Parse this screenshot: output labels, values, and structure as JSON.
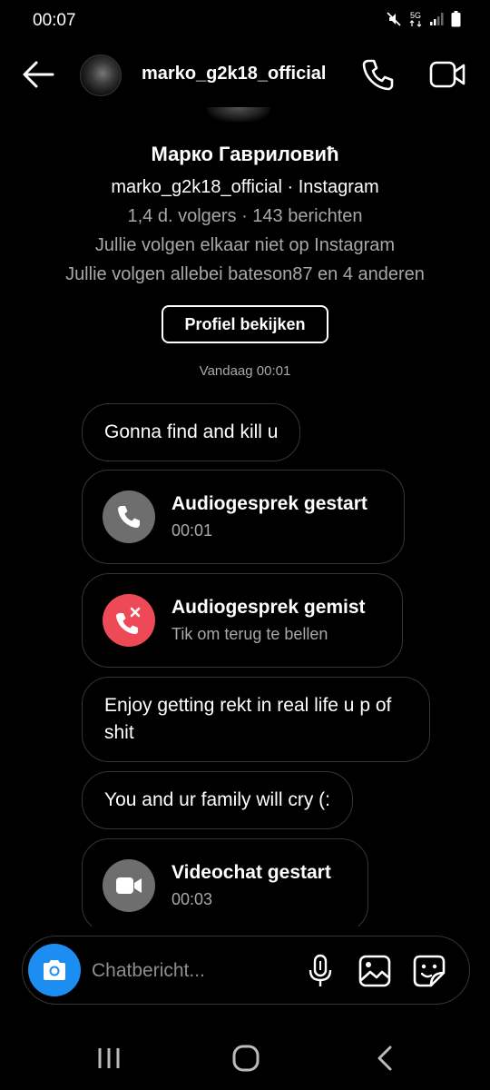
{
  "status_bar": {
    "time": "00:07",
    "network_label": "5G",
    "icons": [
      "mute-icon",
      "signal-icon",
      "battery-icon"
    ]
  },
  "header": {
    "username": "marko_g2k18_official",
    "icons": [
      "back-arrow-icon",
      "phone-icon",
      "video-camera-icon"
    ]
  },
  "profile": {
    "display_name": "Марко Гавриловић",
    "handle_line": "marko_g2k18_official · Instagram",
    "stats_line": "1,4 d. volgers · 143 berichten",
    "follow_status": "Jullie volgen elkaar niet op Instagram",
    "mutuals": "Jullie volgen allebei bateson87 en 4 anderen",
    "view_button": "Profiel bekijken"
  },
  "thread": {
    "timestamp": "Vandaag 00:01",
    "messages": [
      {
        "type": "text",
        "text": "Gonna find and kill u"
      },
      {
        "type": "call",
        "title": "Audiogesprek gestart",
        "subtitle": "00:01",
        "icon": "phone-icon",
        "icon_bg": "#6e6e6e"
      },
      {
        "type": "call",
        "title": "Audiogesprek gemist",
        "subtitle": "Tik om terug te bellen",
        "icon": "missed-call-icon",
        "icon_bg": "#ed4956"
      },
      {
        "type": "text",
        "text": "Enjoy getting rekt in real life u p of shit"
      },
      {
        "type": "text",
        "text": "You and ur family will cry (:"
      },
      {
        "type": "call",
        "title": "Videochat gestart",
        "subtitle": "00:03",
        "icon": "video-camera-icon",
        "icon_bg": "#6e6e6e"
      }
    ]
  },
  "composer": {
    "placeholder": "Chatbericht...",
    "icons": [
      "camera-icon",
      "microphone-icon",
      "gallery-icon",
      "sticker-icon"
    ]
  },
  "system_nav": {
    "icons": [
      "recent-apps-icon",
      "home-icon",
      "back-icon"
    ]
  },
  "colors": {
    "background": "#000000",
    "bubble_border": "#363636",
    "muted_text": "#a8a8a8",
    "camera_button": "#1c8ef2",
    "missed_call": "#ed4956",
    "call_icon_grey": "#6e6e6e"
  }
}
